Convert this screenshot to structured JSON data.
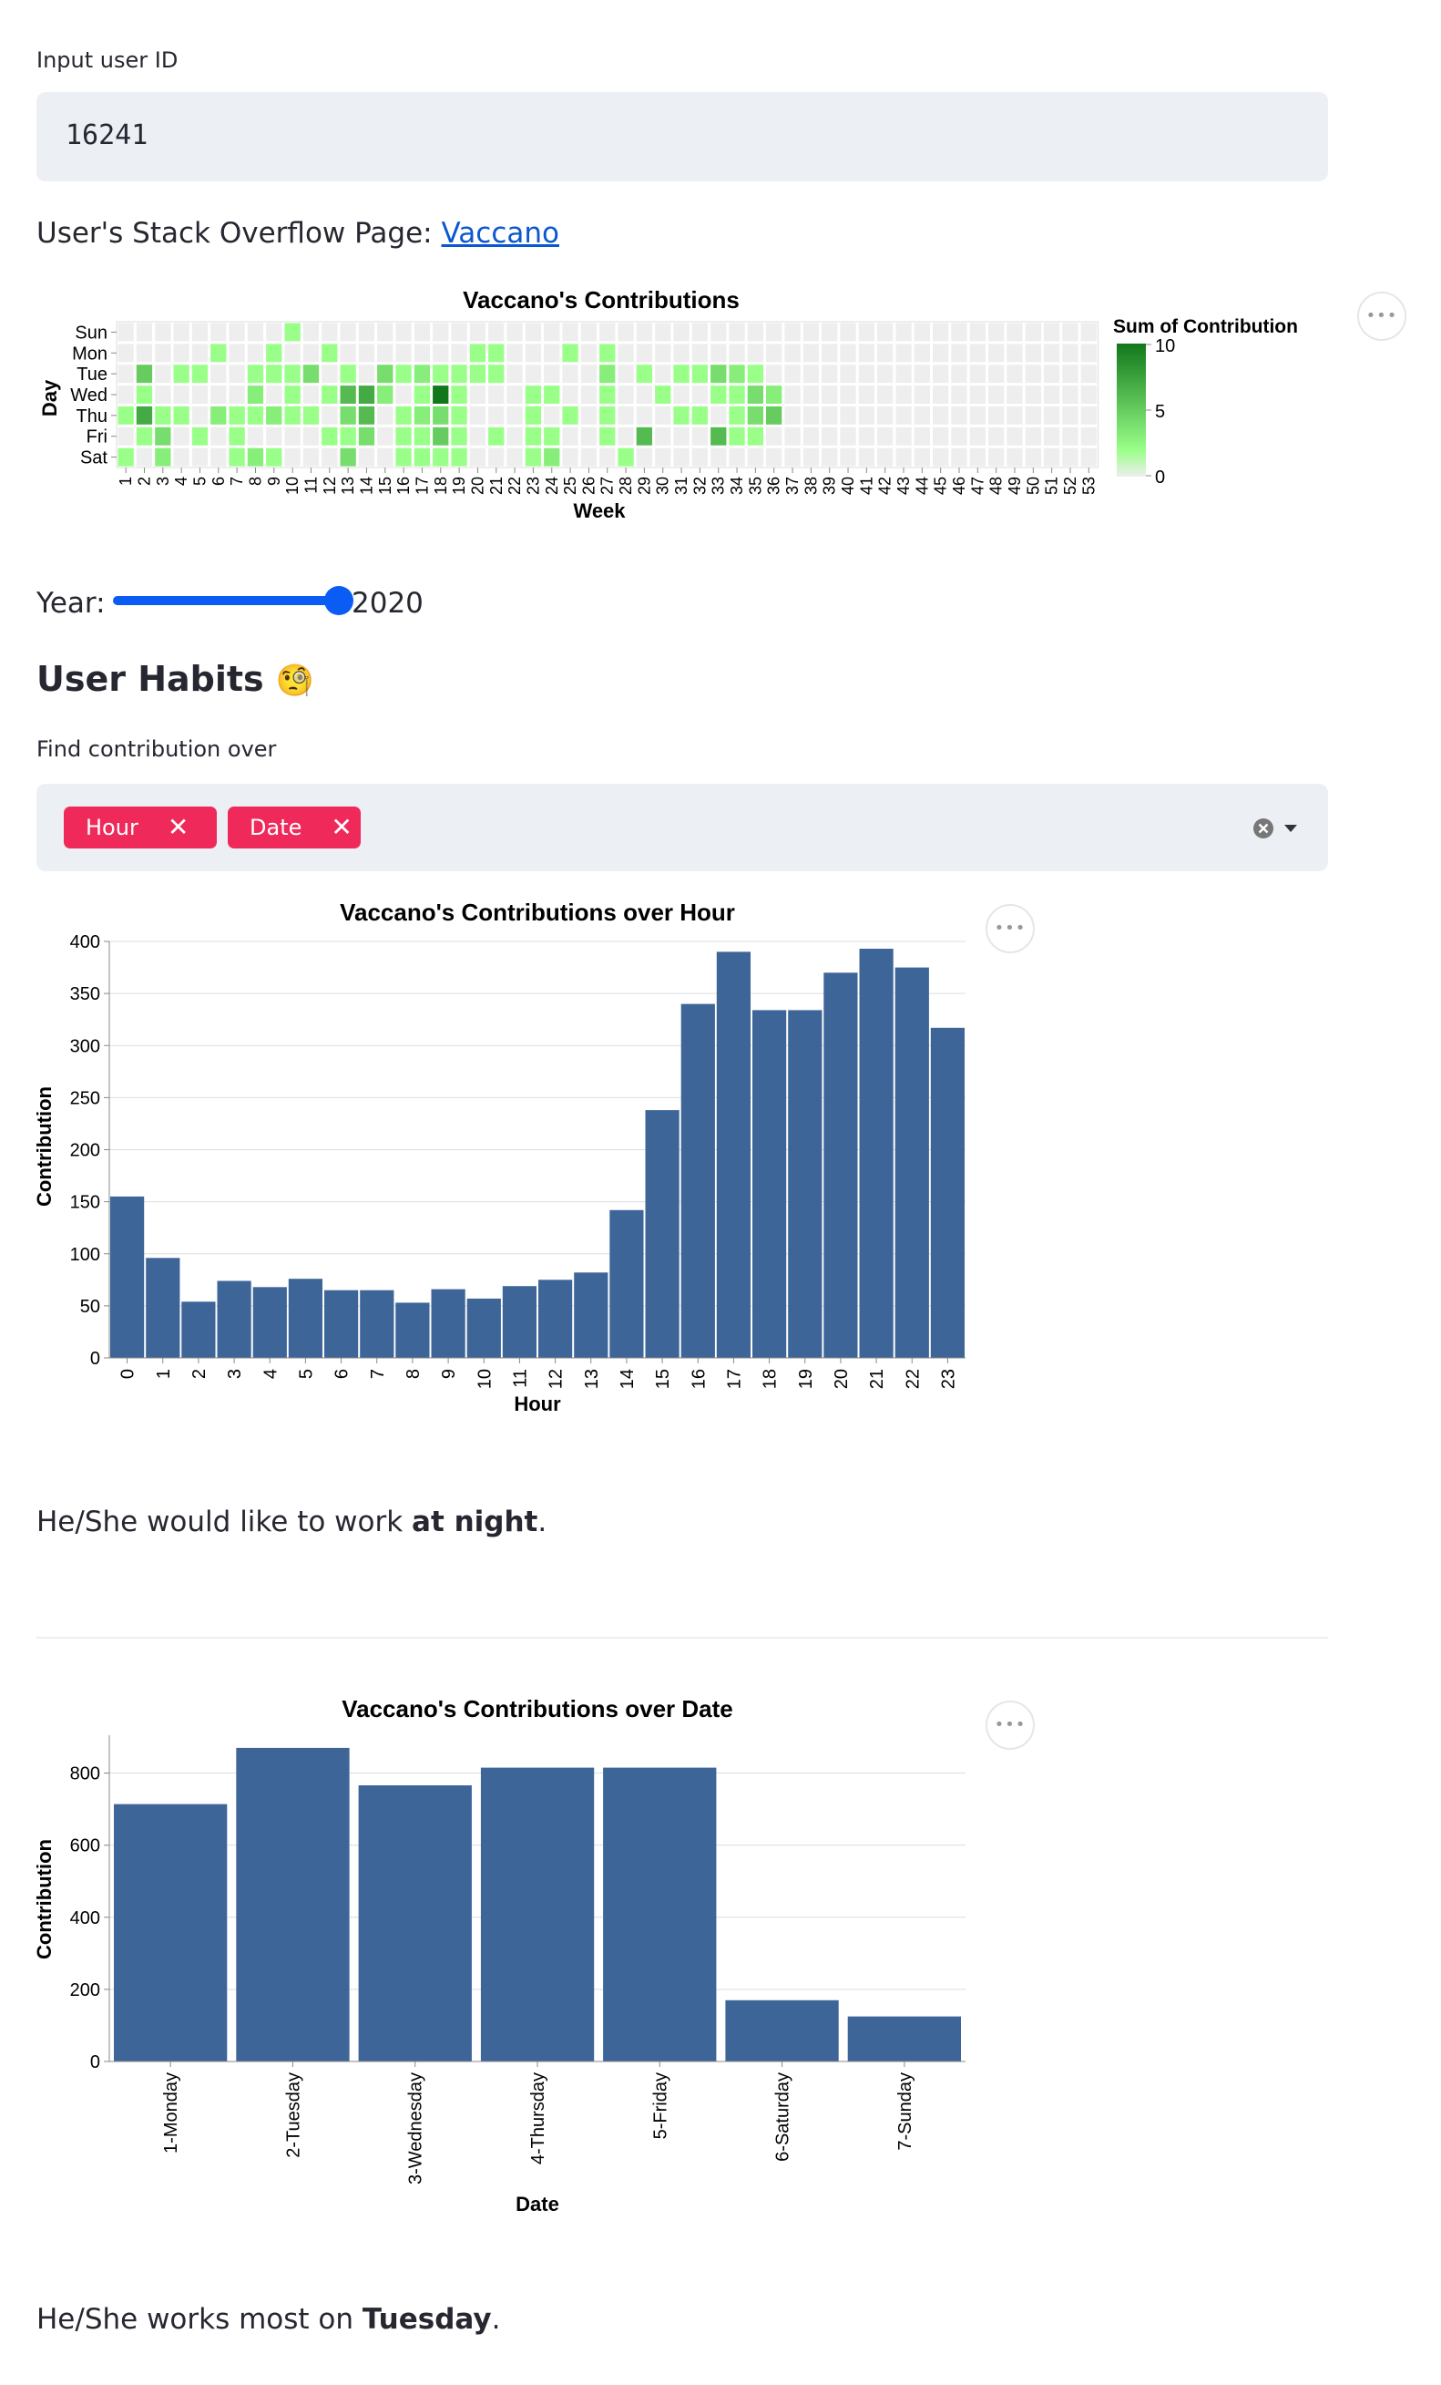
{
  "user_input": {
    "label": "Input user ID",
    "value": "16241"
  },
  "profile": {
    "prefix": "User's Stack Overflow Page: ",
    "link_text": "Vaccano"
  },
  "heatmap": {
    "title": "Vaccano's Contributions",
    "x_label": "Week",
    "y_label": "Day",
    "days": [
      "Sun",
      "Mon",
      "Tue",
      "Wed",
      "Thu",
      "Fri",
      "Sat"
    ],
    "weeks": [
      "1",
      "2",
      "3",
      "4",
      "5",
      "6",
      "7",
      "8",
      "9",
      "10",
      "11",
      "12",
      "13",
      "14",
      "15",
      "16",
      "17",
      "18",
      "19",
      "20",
      "21",
      "22",
      "23",
      "24",
      "25",
      "26",
      "27",
      "28",
      "29",
      "30",
      "31",
      "32",
      "33",
      "34",
      "35",
      "36",
      "37",
      "38",
      "39",
      "40",
      "41",
      "42",
      "43",
      "44",
      "45",
      "46",
      "47",
      "48",
      "49",
      "50",
      "51",
      "52",
      "53"
    ],
    "legend_title": "Sum of Contribution",
    "legend_ticks": [
      "10",
      "5",
      "0"
    ],
    "colors": {
      "empty": "#eeeeee",
      "low": "#99ff88",
      "high": "#11771a"
    },
    "chart_data": {
      "type": "heatmap",
      "title": "Vaccano's Contributions",
      "xlabel": "Week",
      "ylabel": "Day",
      "color_range": [
        0,
        10
      ],
      "rows": [
        "Sun",
        "Mon",
        "Tue",
        "Wed",
        "Thu",
        "Fri",
        "Sat"
      ],
      "values": [
        [
          0,
          0,
          0,
          0,
          0,
          0,
          0,
          0,
          0,
          2,
          0,
          0,
          0,
          0,
          0,
          0,
          0,
          0,
          0,
          0,
          0,
          0,
          0,
          0,
          0,
          0,
          0,
          0,
          0,
          0,
          0,
          0,
          0,
          0,
          0,
          0,
          0,
          0,
          0,
          0,
          0,
          0,
          0,
          0,
          0,
          0,
          0,
          0,
          0,
          0,
          0,
          0,
          0
        ],
        [
          0,
          0,
          0,
          0,
          0,
          2,
          0,
          0,
          2,
          0,
          0,
          2,
          0,
          0,
          0,
          0,
          0,
          0,
          0,
          2,
          2,
          0,
          0,
          0,
          2,
          0,
          2,
          0,
          0,
          0,
          0,
          0,
          0,
          0,
          0,
          0,
          0,
          0,
          0,
          0,
          0,
          0,
          0,
          0,
          0,
          0,
          0,
          0,
          0,
          0,
          0,
          0,
          0
        ],
        [
          0,
          5,
          0,
          2,
          2,
          0,
          0,
          2,
          2,
          2,
          4,
          0,
          2,
          0,
          4,
          2,
          3,
          2,
          2,
          2,
          2,
          0,
          0,
          0,
          0,
          0,
          3,
          0,
          2,
          0,
          2,
          2,
          4,
          3,
          2,
          0,
          0,
          0,
          0,
          0,
          0,
          0,
          0,
          0,
          0,
          0,
          0,
          0,
          0,
          0,
          0,
          0,
          0
        ],
        [
          0,
          2,
          0,
          0,
          0,
          0,
          0,
          3,
          0,
          2,
          0,
          2,
          6,
          7,
          3,
          0,
          2,
          10,
          2,
          0,
          0,
          0,
          2,
          2,
          0,
          0,
          2,
          0,
          0,
          2,
          0,
          0,
          2,
          2,
          4,
          3,
          0,
          0,
          0,
          0,
          0,
          0,
          0,
          0,
          0,
          0,
          0,
          0,
          0,
          0,
          0,
          0,
          0
        ],
        [
          2,
          7,
          2,
          2,
          0,
          3,
          2,
          2,
          3,
          2,
          2,
          0,
          4,
          6,
          0,
          2,
          3,
          4,
          2,
          0,
          0,
          0,
          2,
          0,
          2,
          0,
          2,
          0,
          0,
          0,
          2,
          2,
          0,
          2,
          4,
          5,
          0,
          0,
          0,
          0,
          0,
          0,
          0,
          0,
          0,
          0,
          0,
          0,
          0,
          0,
          0,
          0,
          0
        ],
        [
          0,
          2,
          4,
          0,
          2,
          0,
          2,
          0,
          0,
          0,
          0,
          2,
          2,
          4,
          0,
          2,
          2,
          5,
          2,
          0,
          2,
          0,
          2,
          2,
          0,
          0,
          2,
          0,
          6,
          0,
          0,
          0,
          6,
          2,
          2,
          0,
          0,
          0,
          0,
          0,
          0,
          0,
          0,
          0,
          0,
          0,
          0,
          0,
          0,
          0,
          0,
          0,
          0
        ],
        [
          2,
          0,
          3,
          0,
          0,
          0,
          2,
          3,
          2,
          0,
          0,
          0,
          4,
          0,
          0,
          2,
          2,
          2,
          2,
          0,
          0,
          0,
          2,
          3,
          0,
          0,
          0,
          2,
          0,
          0,
          0,
          0,
          0,
          0,
          0,
          0,
          0,
          0,
          0,
          0,
          0,
          0,
          0,
          0,
          0,
          0,
          0,
          0,
          0,
          0,
          0,
          0,
          0
        ]
      ]
    }
  },
  "year_slider": {
    "label": "Year:",
    "value": "2020",
    "fraction": 1.0,
    "accent": "#0a5cf5"
  },
  "habits": {
    "heading": "User Habits",
    "emoji": "🧐",
    "select_label": "Find contribution over",
    "chips": [
      {
        "label": "Hour"
      },
      {
        "label": "Date"
      }
    ],
    "clear_icon": "clear-circle-icon",
    "dropdown_icon": "caret-down-icon"
  },
  "hour_chart": {
    "title": "Vaccano's Contributions over Hour",
    "x_label": "Hour",
    "y_label": "Contribution",
    "bar_color": "#3e6598",
    "chart_data": {
      "type": "bar",
      "title": "Vaccano's Contributions over Hour",
      "xlabel": "Hour",
      "ylabel": "Contribution",
      "ylim": [
        0,
        400
      ],
      "yticks": [
        "0",
        "50",
        "100",
        "150",
        "200",
        "250",
        "300",
        "350",
        "400"
      ],
      "categories": [
        "0",
        "1",
        "2",
        "3",
        "4",
        "5",
        "6",
        "7",
        "8",
        "9",
        "10",
        "11",
        "12",
        "13",
        "14",
        "15",
        "16",
        "17",
        "18",
        "19",
        "20",
        "21",
        "22",
        "23"
      ],
      "values": [
        155,
        96,
        54,
        74,
        68,
        76,
        65,
        65,
        53,
        66,
        57,
        69,
        75,
        82,
        142,
        238,
        340,
        390,
        334,
        334,
        370,
        393,
        375,
        317
      ]
    }
  },
  "hour_sentence": {
    "prefix": "He/She would like to work ",
    "bold": "at night",
    "suffix": "."
  },
  "date_chart": {
    "title": "Vaccano's Contributions over Date",
    "x_label": "Date",
    "y_label": "Contribution",
    "bar_color": "#3e6598",
    "chart_data": {
      "type": "bar",
      "title": "Vaccano's Contributions over Date",
      "xlabel": "Date",
      "ylabel": "Contribution",
      "ylim": [
        0,
        900
      ],
      "yticks": [
        "0",
        "200",
        "400",
        "600",
        "800"
      ],
      "categories": [
        "1-Monday",
        "2-Tuesday",
        "3-Wednesday",
        "4-Thursday",
        "5-Friday",
        "6-Saturday",
        "7-Sunday"
      ],
      "values": [
        714,
        870,
        766,
        815,
        815,
        170,
        125
      ]
    }
  },
  "date_sentence": {
    "prefix": "He/She works most on ",
    "bold": "Tuesday",
    "suffix": "."
  },
  "menu_icon": "more-horizontal-icon"
}
